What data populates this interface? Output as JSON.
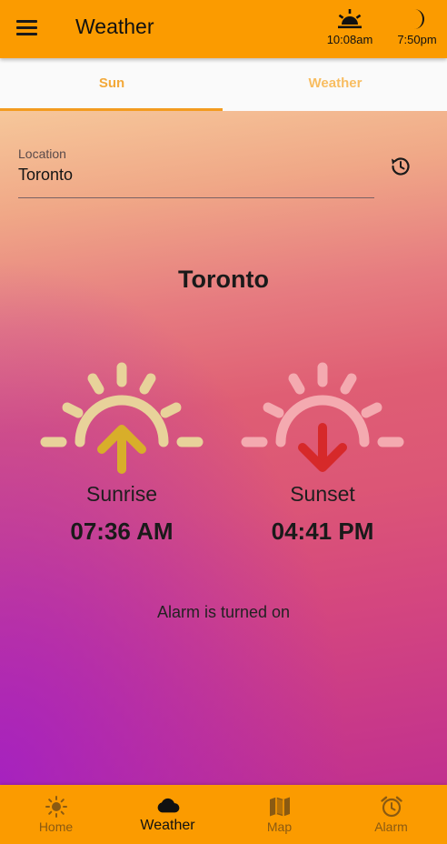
{
  "app_bar": {
    "title": "Weather",
    "sunrise_time": "10:08am",
    "sunset_time": "7:50pm"
  },
  "tabs": [
    {
      "label": "Sun",
      "active": true
    },
    {
      "label": "Weather",
      "active": false
    }
  ],
  "location": {
    "label": "Location",
    "value": "Toronto"
  },
  "city_name": "Toronto",
  "sunrise": {
    "label": "Sunrise",
    "time": "07:36 AM",
    "icon": "sunrise-icon",
    "color": "#e8d29a",
    "arrow_color": "#d8ae2a"
  },
  "sunset": {
    "label": "Sunset",
    "time": "04:41 PM",
    "icon": "sunset-icon",
    "color": "#f4aab0",
    "arrow_color": "#d6292a"
  },
  "alarm_status": "Alarm is turned on",
  "bottom_nav": [
    {
      "label": "Home",
      "icon": "sun-icon",
      "active": false
    },
    {
      "label": "Weather",
      "icon": "cloud-icon",
      "active": true
    },
    {
      "label": "Map",
      "icon": "map-icon",
      "active": false
    },
    {
      "label": "Alarm",
      "icon": "alarm-clock-icon",
      "active": false
    }
  ],
  "colors": {
    "primary": "#fb9b00",
    "tab_text": "#f3a93a",
    "tab_indicator": "#f39b1f"
  }
}
